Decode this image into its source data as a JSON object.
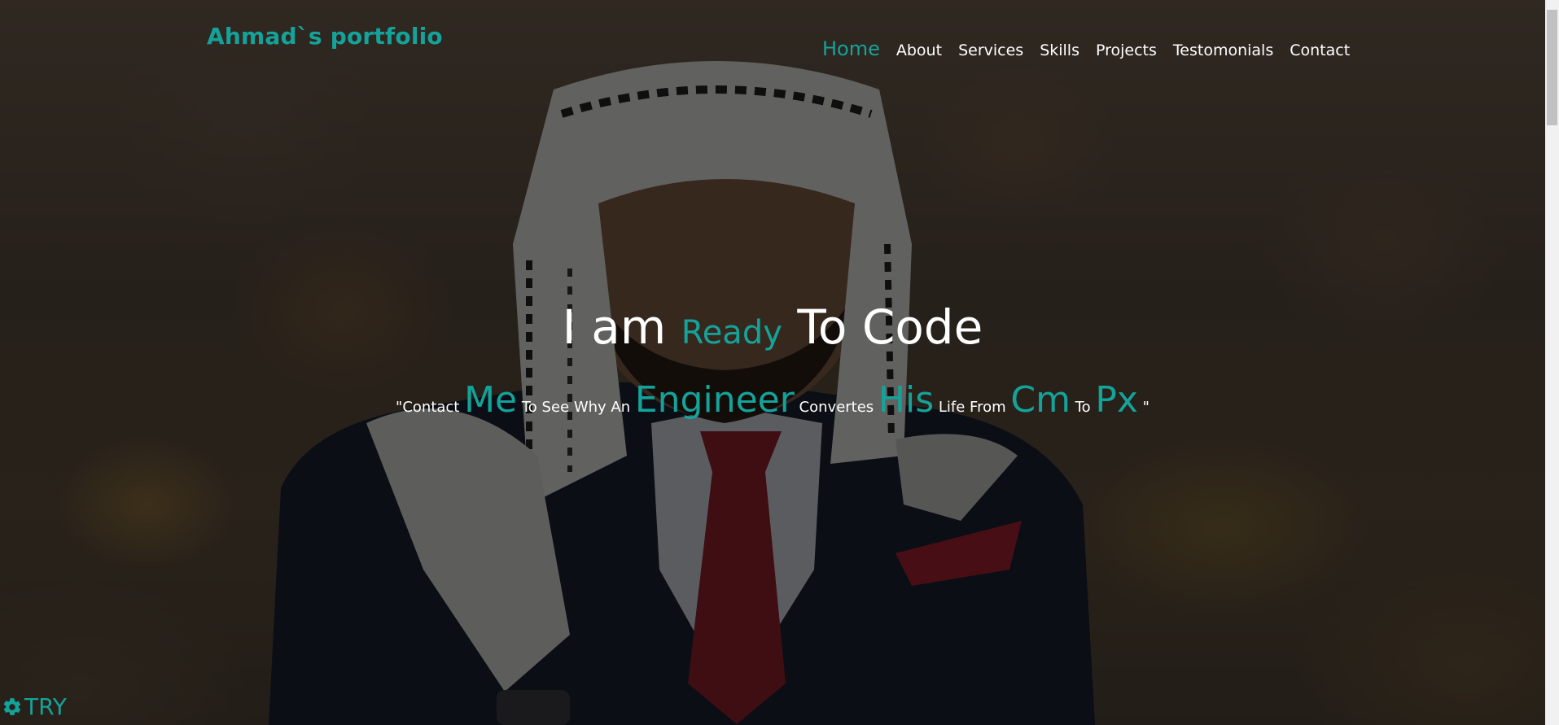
{
  "header": {
    "brand": "Ahmad`s portfolio",
    "nav": [
      {
        "label": "Home",
        "active": true
      },
      {
        "label": "About"
      },
      {
        "label": "Services"
      },
      {
        "label": "Skills"
      },
      {
        "label": "Projects"
      },
      {
        "label": "Testomonials"
      },
      {
        "label": "Contact"
      }
    ]
  },
  "hero": {
    "title_before": "I am ",
    "title_accent": "Ready",
    "title_after": " To Code",
    "tagline": [
      {
        "text": "\"Contact ",
        "big": false
      },
      {
        "text": "Me",
        "big": true
      },
      {
        "text": " To See Why An ",
        "big": false
      },
      {
        "text": "Engineer",
        "big": true
      },
      {
        "text": " Convertes ",
        "big": false
      },
      {
        "text": "His",
        "big": true
      },
      {
        "text": " Life From ",
        "big": false
      },
      {
        "text": "Cm",
        "big": true
      },
      {
        "text": " To ",
        "big": false
      },
      {
        "text": "Px",
        "big": true
      },
      {
        "text": " \"",
        "big": false
      }
    ]
  },
  "widget": {
    "label": "TRY",
    "icon": "gear-icon"
  },
  "colors": {
    "accent": "#14a39a",
    "text": "#ffffff"
  }
}
